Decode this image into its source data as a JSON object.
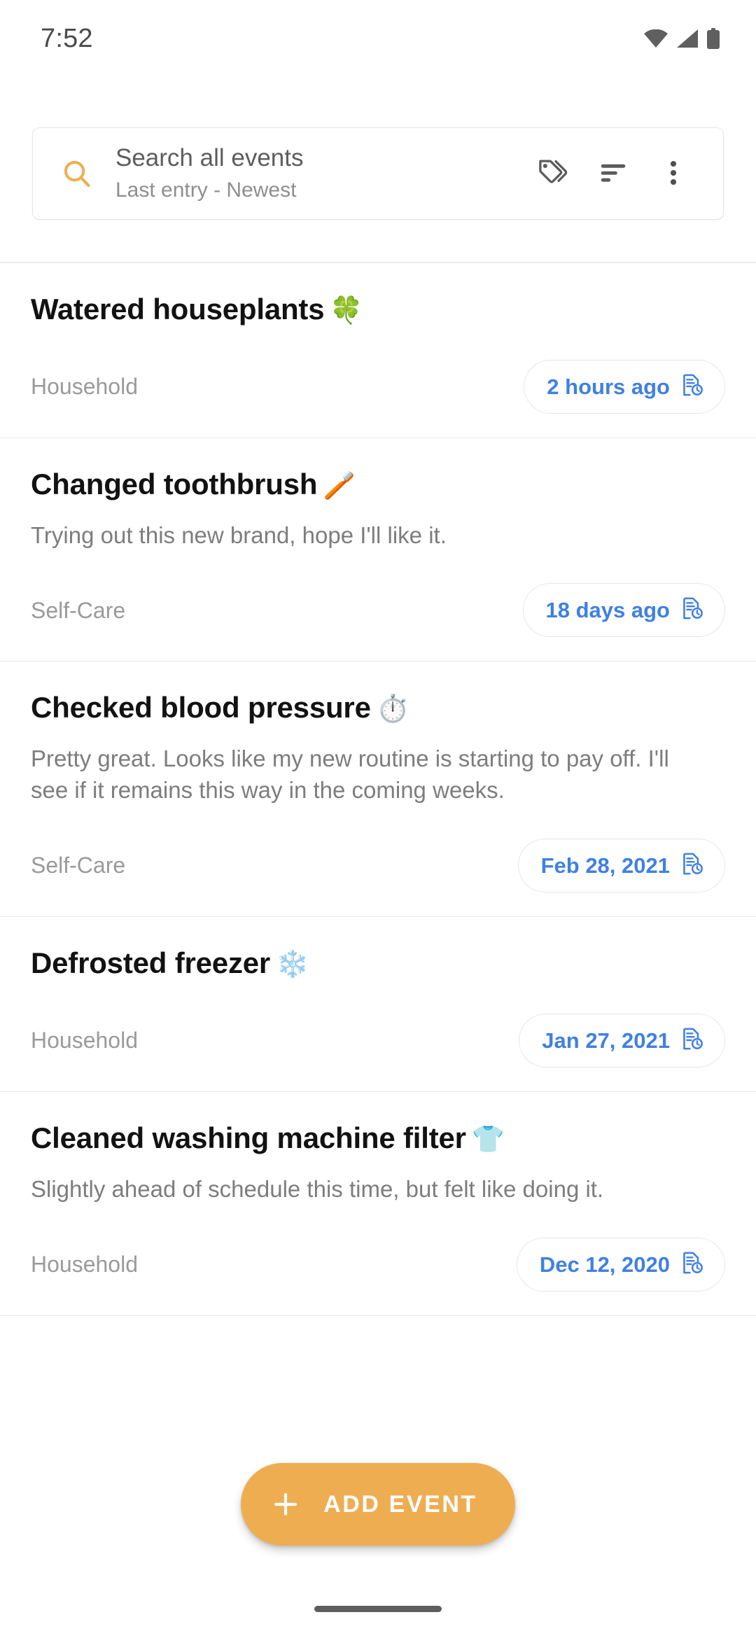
{
  "status_bar": {
    "time": "7:52",
    "icons": [
      "wifi-icon",
      "cellular-signal-icon",
      "battery-icon"
    ]
  },
  "search": {
    "icon": "search-icon",
    "title": "Search all events",
    "subtitle": "Last entry - Newest",
    "placeholder": "Search all events",
    "actions": [
      {
        "name": "tags-icon",
        "label": "Tags"
      },
      {
        "name": "sort-icon",
        "label": "Sort"
      },
      {
        "name": "overflow-menu-icon",
        "label": "More options"
      }
    ]
  },
  "events": [
    {
      "title": "Watered houseplants",
      "emoji": "🍀",
      "note": "",
      "category": "Household",
      "timestamp": "2 hours ago",
      "timestamp_icon": "document-history-icon"
    },
    {
      "title": "Changed toothbrush",
      "emoji": "🪥",
      "note": "Trying out this new brand, hope I'll like it.",
      "category": "Self-Care",
      "timestamp": "18 days ago",
      "timestamp_icon": "document-history-icon"
    },
    {
      "title": "Checked blood pressure",
      "emoji": "⏱️",
      "note": "Pretty great. Looks like my new routine is starting to pay off. I'll see if it remains this way in the coming weeks.",
      "category": "Self-Care",
      "timestamp": "Feb 28, 2021",
      "timestamp_icon": "document-history-icon"
    },
    {
      "title": "Defrosted freezer",
      "emoji": "❄️",
      "note": "",
      "category": "Household",
      "timestamp": "Jan 27, 2021",
      "timestamp_icon": "document-history-icon"
    },
    {
      "title": "Cleaned washing machine filter",
      "emoji": "👕",
      "note": "Slightly ahead of schedule this time, but felt like doing it.",
      "category": "Household",
      "timestamp": "Dec 12, 2020",
      "timestamp_icon": "document-history-icon"
    }
  ],
  "fab": {
    "label": "ADD EVENT",
    "icon": "plus-icon"
  },
  "colors": {
    "accent_orange": "#efad52",
    "link_blue": "#3f80e4",
    "title_black": "#121212",
    "muted_gray": "#9a9a9a",
    "note_gray": "#7d7d7d",
    "divider": "#e9e9e9",
    "background": "#ffffff"
  }
}
